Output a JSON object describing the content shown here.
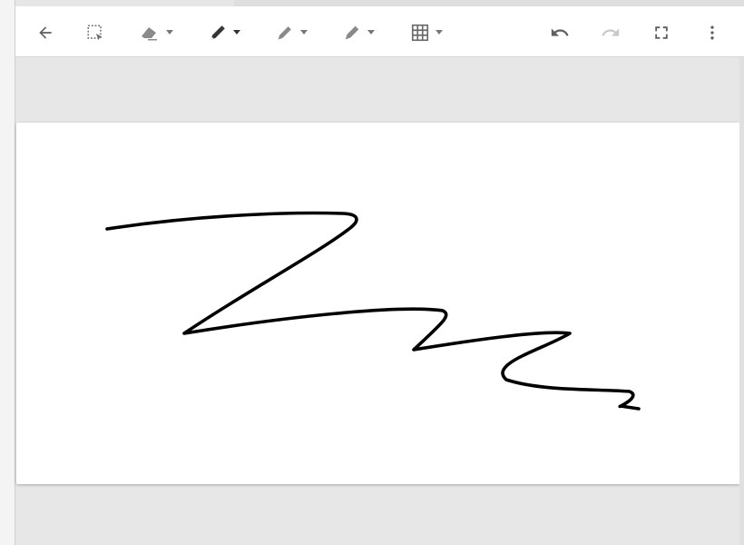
{
  "toolbar": {
    "buttons": [
      {
        "id": "back",
        "icon": "arrow-left-icon",
        "enabled": true
      },
      {
        "id": "select",
        "icon": "lasso-select-icon",
        "enabled": true
      },
      {
        "id": "eraser",
        "icon": "eraser-icon",
        "enabled": true,
        "has_menu": true
      },
      {
        "id": "pen",
        "icon": "pen-icon",
        "enabled": true,
        "selected": true,
        "has_menu": true
      },
      {
        "id": "pencil",
        "icon": "pencil-icon",
        "enabled": true,
        "has_menu": true
      },
      {
        "id": "highlighter",
        "icon": "highlighter-icon",
        "enabled": true,
        "has_menu": true
      },
      {
        "id": "grid",
        "icon": "grid-icon",
        "enabled": true,
        "has_menu": true
      },
      {
        "id": "undo",
        "icon": "undo-icon",
        "enabled": true
      },
      {
        "id": "redo",
        "icon": "redo-icon",
        "enabled": false
      },
      {
        "id": "fullscreen",
        "icon": "fullscreen-icon",
        "enabled": true
      },
      {
        "id": "more",
        "icon": "more-vert-icon",
        "enabled": true
      }
    ]
  },
  "colors": {
    "icon_active": "#333333",
    "icon_muted": "#777777",
    "icon_disabled": "#c8c8c8",
    "workspace": "#e7e7e7",
    "canvas": "#ffffff",
    "ink": "#000000"
  },
  "canvas": {
    "strokes": [
      {
        "tool": "pen",
        "color": "#000000"
      }
    ]
  }
}
